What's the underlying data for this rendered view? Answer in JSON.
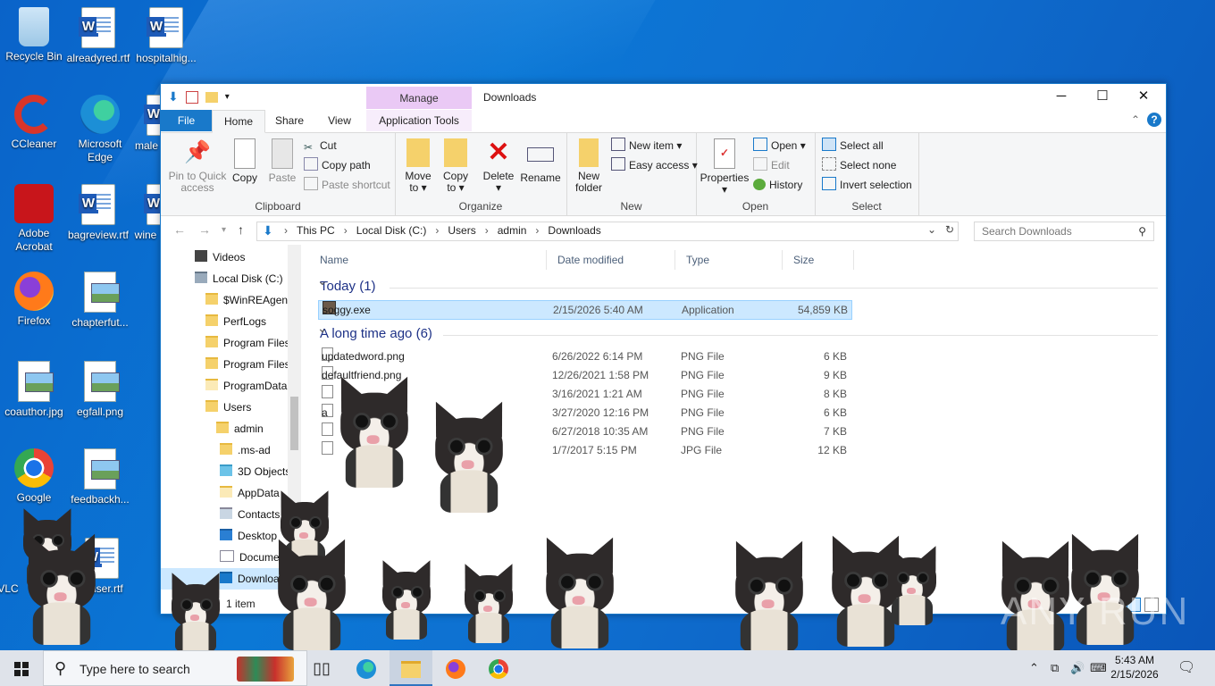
{
  "desktop": {
    "icons": [
      {
        "label": "Recycle Bin",
        "icon": "recycle-bin-icon"
      },
      {
        "label": "alreadyred.rtf",
        "icon": "word-document-icon"
      },
      {
        "label": "hospitalhig...",
        "icon": "word-document-icon"
      },
      {
        "label": "CCleaner",
        "icon": "ccleaner-icon"
      },
      {
        "label": "Microsoft Edge",
        "icon": "edge-icon"
      },
      {
        "label": "male",
        "icon": "word-document-icon"
      },
      {
        "label": "Adobe Acrobat",
        "icon": "acrobat-icon"
      },
      {
        "label": "bagreview.rtf",
        "icon": "word-document-icon"
      },
      {
        "label": "wine",
        "icon": "word-document-icon"
      },
      {
        "label": "Firefox",
        "icon": "firefox-icon"
      },
      {
        "label": "chapterfut...",
        "icon": "image-file-icon"
      },
      {
        "label": "coauthor.jpg",
        "icon": "image-file-icon"
      },
      {
        "label": "egfall.png",
        "icon": "image-file-icon"
      },
      {
        "label": "Google",
        "icon": "chrome-icon"
      },
      {
        "label": "feedbackh...",
        "icon": "image-file-icon"
      },
      {
        "label": "VLC",
        "icon": "vlc-icon"
      },
      {
        "label": "rduser.rtf",
        "icon": "word-document-icon"
      }
    ]
  },
  "window": {
    "title": "Downloads",
    "context_tab": "Manage",
    "controls": {
      "minimize": "─",
      "maximize": "☐",
      "close": "✕"
    }
  },
  "ribbon": {
    "tabs": {
      "file": "File",
      "home": "Home",
      "share": "Share",
      "view": "View",
      "app_tools": "Application Tools"
    },
    "clipboard": {
      "title": "Clipboard",
      "pin": "Pin to Quick access",
      "copy": "Copy",
      "paste": "Paste",
      "cut": "Cut",
      "copy_path": "Copy path",
      "paste_shortcut": "Paste shortcut"
    },
    "organize": {
      "title": "Organize",
      "move_to": "Move to ▾",
      "copy_to": "Copy to ▾",
      "delete": "Delete ▾",
      "rename": "Rename"
    },
    "new": {
      "title": "New",
      "new_folder": "New folder",
      "new_item": "New item ▾",
      "easy_access": "Easy access ▾"
    },
    "open": {
      "title": "Open",
      "properties": "Properties ▾",
      "open": "Open ▾",
      "edit": "Edit",
      "history": "History"
    },
    "select": {
      "title": "Select",
      "select_all": "Select all",
      "select_none": "Select none",
      "invert": "Invert selection"
    }
  },
  "address": {
    "crumbs": [
      "This PC",
      "Local Disk (C:)",
      "Users",
      "admin",
      "Downloads"
    ],
    "search_placeholder": "Search Downloads"
  },
  "navpane": {
    "items": [
      {
        "label": "Videos",
        "indent": 0
      },
      {
        "label": "Local Disk (C:)",
        "indent": 0
      },
      {
        "label": "$WinREAgent",
        "indent": 1
      },
      {
        "label": "PerfLogs",
        "indent": 1
      },
      {
        "label": "Program Files",
        "indent": 1
      },
      {
        "label": "Program Files",
        "indent": 1
      },
      {
        "label": "ProgramData",
        "indent": 1
      },
      {
        "label": "Users",
        "indent": 1
      },
      {
        "label": "admin",
        "indent": 2
      },
      {
        "label": ".ms-ad",
        "indent": 3
      },
      {
        "label": "3D Objects",
        "indent": 3
      },
      {
        "label": "AppData",
        "indent": 3
      },
      {
        "label": "Contacts",
        "indent": 3
      },
      {
        "label": "Desktop",
        "indent": 3
      },
      {
        "label": "Documents",
        "indent": 3
      },
      {
        "label": "Downloads",
        "indent": 3
      }
    ]
  },
  "columns": {
    "name": "Name",
    "date": "Date modified",
    "type": "Type",
    "size": "Size"
  },
  "groups": {
    "today": {
      "label": "Today (1)",
      "files": [
        {
          "name": "soggy.exe",
          "date": "2/15/2026 5:40 AM",
          "type": "Application",
          "size": "54,859 KB"
        }
      ]
    },
    "older": {
      "label": "A long time ago (6)",
      "files": [
        {
          "name": "updatedword.png",
          "date": "6/26/2022 6:14 PM",
          "type": "PNG File",
          "size": "6 KB"
        },
        {
          "name": "defaultfriend.png",
          "date": "12/26/2021 1:58 PM",
          "type": "PNG File",
          "size": "9 KB"
        },
        {
          "name": "",
          "date": "3/16/2021 1:21 AM",
          "type": "PNG File",
          "size": "8 KB"
        },
        {
          "name": "a",
          "date": "3/27/2020 12:16 PM",
          "type": "PNG File",
          "size": "6 KB"
        },
        {
          "name": "",
          "date": "6/27/2018 10:35 AM",
          "type": "PNG File",
          "size": "7 KB"
        },
        {
          "name": "",
          "date": "1/7/2017 5:15 PM",
          "type": "JPG File",
          "size": "12 KB"
        }
      ]
    }
  },
  "status": {
    "count": "1 item"
  },
  "taskbar": {
    "search_placeholder": "Type here to search",
    "time": "5:43 AM",
    "date": "2/15/2026"
  },
  "watermark": "ANY RUN"
}
